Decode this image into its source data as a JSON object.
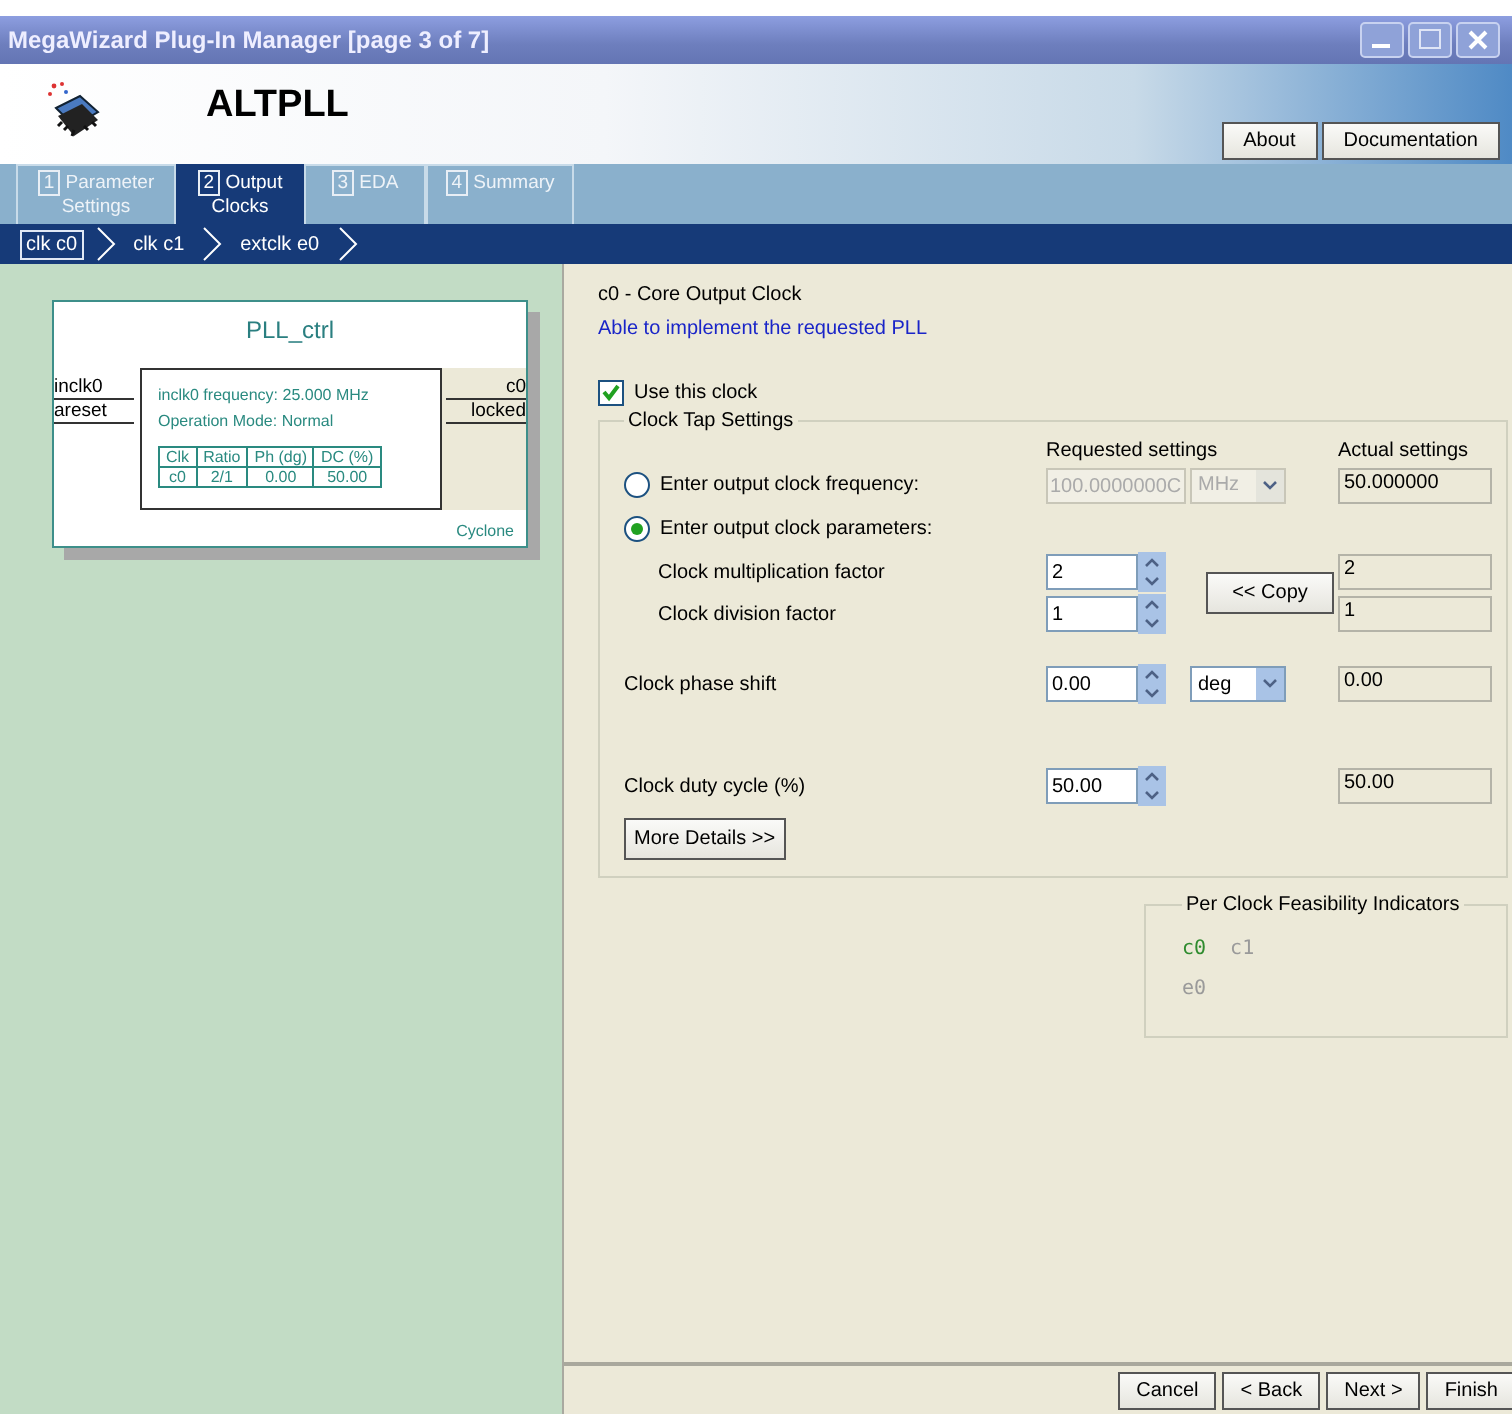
{
  "window": {
    "title": "MegaWizard Plug-In Manager [page 3 of 7]"
  },
  "header": {
    "title": "ALTPLL",
    "buttons": [
      "About",
      "Documentation"
    ]
  },
  "tabs": [
    {
      "number": "1",
      "label": "Parameter Settings",
      "selected": false
    },
    {
      "number": "2",
      "label": "Output Clocks",
      "selected": true
    },
    {
      "number": "3",
      "label": "EDA",
      "selected": false
    },
    {
      "number": "4",
      "label": "Summary",
      "selected": false
    }
  ],
  "breadcrumbs": [
    {
      "label": "clk c0",
      "selected": true
    },
    {
      "label": "clk c1",
      "selected": false
    },
    {
      "label": "extclk e0",
      "selected": false
    }
  ],
  "diagram": {
    "name": "PLL_ctrl",
    "inputs": [
      "inclk0",
      "areset"
    ],
    "outputs": [
      "c0",
      "locked"
    ],
    "info": [
      "inclk0 frequency: 25.000 MHz",
      "Operation Mode: Normal"
    ],
    "columns": [
      "Clk",
      "Ratio",
      "Ph (dg)",
      "DC (%)"
    ],
    "rows": [
      [
        "c0",
        "2/1",
        "0.00",
        "50.00"
      ]
    ],
    "family": "Cyclone"
  },
  "panel": {
    "heading": "c0 - Core Output Clock",
    "status": "Able to implement the requested PLL"
  },
  "use_clock": {
    "label": "Use this clock",
    "checked": true
  },
  "clock_tap": {
    "title": "Clock Tap Settings",
    "headers": [
      "Requested settings",
      "Actual settings"
    ],
    "frequency_option": {
      "label": "Enter output clock frequency:",
      "selected": false,
      "value": "100.0000000C",
      "unit": "MHz",
      "disabled": true,
      "actual": "50.000000"
    },
    "parameters_option": {
      "label": "Enter output clock parameters:",
      "selected": true,
      "factors": [
        {
          "label": "Clock multiplication factor",
          "value": "2",
          "actual": "2"
        },
        {
          "label": "Clock division factor",
          "value": "1",
          "actual": "1"
        }
      ],
      "copy_button": "<< Copy"
    },
    "phase": {
      "label": "Clock phase shift",
      "value": "0.00",
      "unit": "deg",
      "actual": "0.00"
    },
    "duty": {
      "label": "Clock duty cycle (%)",
      "value": "50.00",
      "actual": "50.00"
    },
    "more_button": "More Details >>"
  },
  "feasibility": {
    "title": "Per Clock Feasibility Indicators",
    "rows": [
      [
        {
          "label": "c0",
          "color": "#2e8b2e"
        },
        {
          "label": "c1",
          "color": "#9a9a9a"
        }
      ],
      [
        {
          "label": "e0",
          "color": "#9a9a9a"
        }
      ]
    ]
  },
  "footer": {
    "buttons": [
      "Cancel",
      "< Back",
      "Next >",
      "Finish"
    ]
  }
}
